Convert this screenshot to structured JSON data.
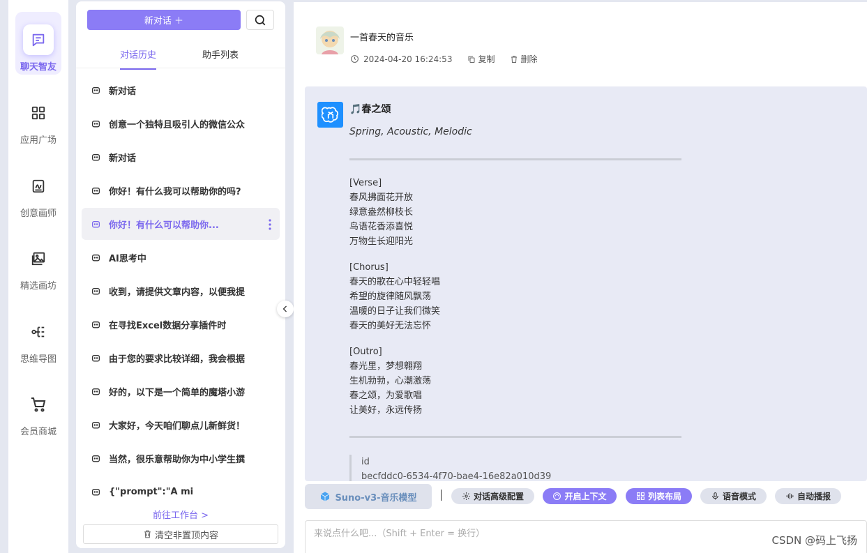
{
  "rail": [
    {
      "label": "聊天智友",
      "icon": "chat-icon",
      "active": true
    },
    {
      "label": "应用广场",
      "icon": "apps-grid-icon"
    },
    {
      "label": "创意画师",
      "icon": "draw-icon"
    },
    {
      "label": "精选画坊",
      "icon": "gallery-icon"
    },
    {
      "label": "思维导图",
      "icon": "mindmap-icon"
    },
    {
      "label": "会员商城",
      "icon": "cart-icon"
    }
  ],
  "panel": {
    "new_chat": "新对话 ＋",
    "tabs": [
      "对话历史",
      "助手列表"
    ],
    "items": [
      "新对话",
      "创意一个独特且吸引人的微信公众",
      "新对话",
      "你好！有什么我可以帮助你的吗?",
      "你好！有什么可以帮助你...",
      "AI思考中",
      "收到，请提供文章内容，以便我提",
      "在寻找Excel数据分享插件时",
      "由于您的要求比较详细，我会根据",
      "好的，以下是一个简单的魔塔小游",
      "大家好，今天咱们聊点儿新鲜货！",
      "当然，很乐意帮助你为中小学生撰",
      "{\"prompt\":\"A mi"
    ],
    "goto": "前往工作台 >",
    "clear": "清空非置顶内容"
  },
  "question": {
    "text": "一首春天的音乐",
    "time": "2024-04-20 16:24:53",
    "copy": "复制",
    "delete": "删除"
  },
  "answer": {
    "title": "🎵春之颂",
    "style": "Spring, Acoustic, Melodic",
    "verse_tag": "[Verse]",
    "verse": [
      "春风拂面花开放",
      "绿意盎然柳枝长",
      "鸟语花香添喜悦",
      "万物生长迎阳光"
    ],
    "chorus_tag": "[Chorus]",
    "chorus": [
      "春天的歌在心中轻轻唱",
      "希望的旋律随风飘荡",
      "温暖的日子让我们微笑",
      "春天的美好无法忘怀"
    ],
    "outro_tag": "[Outro]",
    "outro": [
      "春光里，梦想翱翔",
      "生机勃勃，心潮激荡",
      "春之颂，为爱歌唱",
      "让美好，永远传扬"
    ],
    "quote_label": "id",
    "quote_value": "becfddc0-6534-4f70-bae4-16e82a010d39"
  },
  "toolbar": {
    "model": "Suno-v3-音乐模型",
    "buttons": [
      {
        "label": "对话高级配置",
        "style": "grey",
        "icon": "gear-icon"
      },
      {
        "label": "开启上下文",
        "style": "purple",
        "icon": "context-icon"
      },
      {
        "label": "列表布局",
        "style": "purple",
        "icon": "grid-icon"
      },
      {
        "label": "语音模式",
        "style": "grey",
        "icon": "mic-icon"
      },
      {
        "label": "自动播报",
        "style": "grey",
        "icon": "audio-wave-icon"
      }
    ]
  },
  "input": {
    "placeholder": "来说点什么吧...（Shift + Enter = 换行）"
  },
  "watermark": "CSDN @码上飞扬",
  "colors": {
    "accent": "#8b7cf6",
    "answer_bg": "#e8eaf5",
    "ai_logo": "#1e90ff"
  }
}
